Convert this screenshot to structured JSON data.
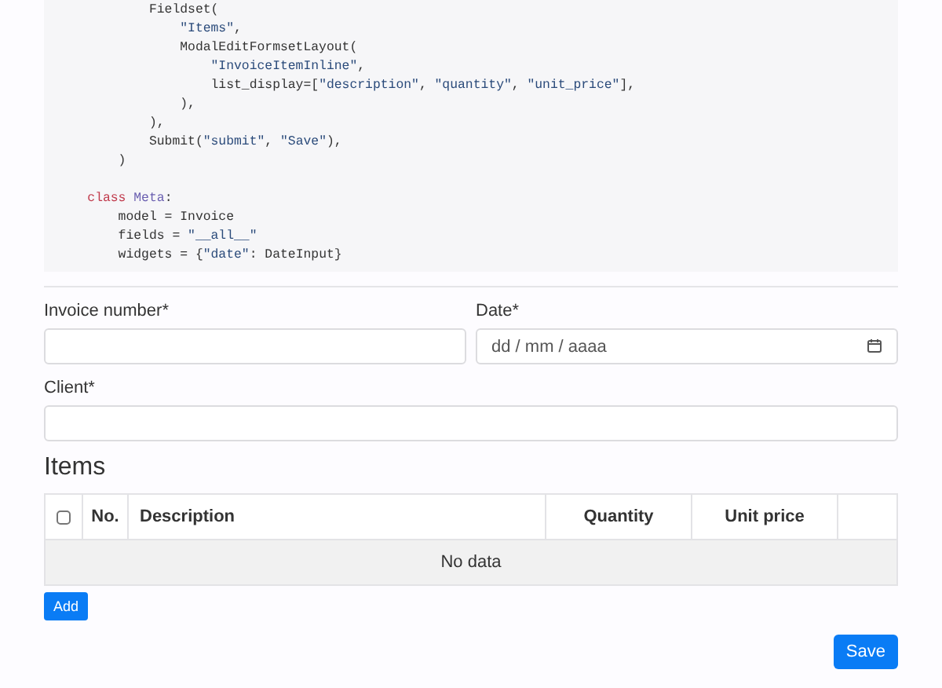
{
  "code": [
    {
      "tokens": [
        {
          "text": "            Fieldset(",
          "kind": "plain"
        }
      ]
    },
    {
      "tokens": [
        {
          "text": "                \"Items\"",
          "kind": "string"
        },
        {
          "text": ",",
          "kind": "plain"
        }
      ]
    },
    {
      "tokens": [
        {
          "text": "                ModalEditFormsetLayout(",
          "kind": "plain"
        }
      ]
    },
    {
      "tokens": [
        {
          "text": "                    \"InvoiceItemInline\"",
          "kind": "string"
        },
        {
          "text": ",",
          "kind": "plain"
        }
      ]
    },
    {
      "tokens": [
        {
          "text": "                    list_display=[",
          "kind": "plain"
        },
        {
          "text": "\"description\"",
          "kind": "string"
        },
        {
          "text": ", ",
          "kind": "plain"
        },
        {
          "text": "\"quantity\"",
          "kind": "string"
        },
        {
          "text": ", ",
          "kind": "plain"
        },
        {
          "text": "\"unit_price\"",
          "kind": "string"
        },
        {
          "text": "],",
          "kind": "plain"
        }
      ]
    },
    {
      "tokens": [
        {
          "text": "                ),",
          "kind": "plain"
        }
      ]
    },
    {
      "tokens": [
        {
          "text": "            ),",
          "kind": "plain"
        }
      ]
    },
    {
      "tokens": [
        {
          "text": "            Submit(",
          "kind": "plain"
        },
        {
          "text": "\"submit\"",
          "kind": "string"
        },
        {
          "text": ", ",
          "kind": "plain"
        },
        {
          "text": "\"Save\"",
          "kind": "string"
        },
        {
          "text": "),",
          "kind": "plain"
        }
      ]
    },
    {
      "tokens": [
        {
          "text": "        )",
          "kind": "plain"
        }
      ]
    },
    {
      "gap_before": true,
      "tokens": [
        {
          "text": "    class",
          "kind": "keyword"
        },
        {
          "text": " Meta",
          "kind": "classname"
        },
        {
          "text": ":",
          "kind": "plain"
        }
      ]
    },
    {
      "tokens": [
        {
          "text": "        model = Invoice",
          "kind": "plain"
        }
      ]
    },
    {
      "tokens": [
        {
          "text": "        fields = ",
          "kind": "plain"
        },
        {
          "text": "\"__all__\"",
          "kind": "string"
        }
      ]
    },
    {
      "tokens": [
        {
          "text": "        widgets = {",
          "kind": "plain"
        },
        {
          "text": "\"date\"",
          "kind": "string"
        },
        {
          "text": ": DateInput}",
          "kind": "plain"
        }
      ]
    }
  ],
  "fields": [
    {
      "label": "Invoice number*",
      "kind": "text"
    },
    {
      "label": "Date*",
      "kind": "date",
      "placeholder": "dd / mm / aaaa"
    }
  ],
  "client": {
    "label": "Client*"
  },
  "items": {
    "title": "Items",
    "select_all": {
      "checked": false
    },
    "columns": [
      "No.",
      "Description",
      "Quantity",
      "Unit price"
    ],
    "empty": "No data",
    "add": "Add"
  },
  "save": "Save"
}
